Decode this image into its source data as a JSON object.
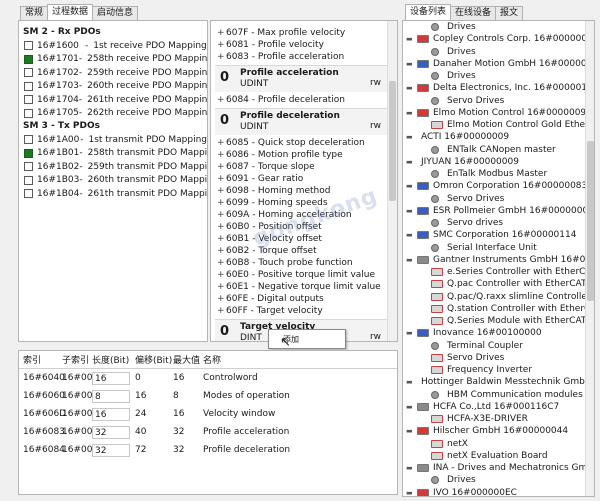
{
  "left_tabs": [
    "常规",
    "过程数据",
    "启动信息"
  ],
  "right_tabs": [
    "设备列表",
    "在线设备",
    "报文"
  ],
  "pdo": {
    "sections": [
      {
        "title": "SM 2 - Rx PDOs",
        "items": [
          {
            "index": "16#1600",
            "name": "1st receive PDO Mapping",
            "checked": false
          },
          {
            "index": "16#1701",
            "name": "258th receive PDO Mapping",
            "checked": true
          },
          {
            "index": "16#1702",
            "name": "259th receive PDO Mapping",
            "checked": false
          },
          {
            "index": "16#1703",
            "name": "260th receive PDO Mapping",
            "checked": false
          },
          {
            "index": "16#1704",
            "name": "261th receive PDO Mapping",
            "checked": false
          },
          {
            "index": "16#1705",
            "name": "262th receive PDO Mapping",
            "checked": false
          }
        ]
      },
      {
        "title": "SM 3 - Tx PDOs",
        "items": [
          {
            "index": "16#1A00",
            "name": "1st transmit PDO Mapping",
            "checked": false
          },
          {
            "index": "16#1B01",
            "name": "258th transmit PDO Mapping",
            "checked": true
          },
          {
            "index": "16#1B02",
            "name": "259th transmit PDO Mapping",
            "checked": false
          },
          {
            "index": "16#1B03",
            "name": "260th transmit PDO Mapping",
            "checked": false
          },
          {
            "index": "16#1B04",
            "name": "261th transmit PDO Mapping",
            "checked": false
          }
        ]
      }
    ]
  },
  "objects": [
    {
      "kind": "row",
      "text": "607F - Max profile velocity"
    },
    {
      "kind": "row",
      "text": "6081 - Profile velocity"
    },
    {
      "kind": "row",
      "text": "6083 - Profile acceleration"
    },
    {
      "kind": "box",
      "num": "0",
      "name": "Profile acceleration",
      "type": "UDINT",
      "access": "rw"
    },
    {
      "kind": "row",
      "text": "6084 - Profile deceleration"
    },
    {
      "kind": "box",
      "num": "0",
      "name": "Profile deceleration",
      "type": "UDINT",
      "access": "rw"
    },
    {
      "kind": "row",
      "text": "6085 - Quick stop deceleration"
    },
    {
      "kind": "row",
      "text": "6086 - Motion profile type"
    },
    {
      "kind": "row",
      "text": "6087 - Torque slope"
    },
    {
      "kind": "row",
      "text": "6091 - Gear ratio"
    },
    {
      "kind": "row",
      "text": "6098 - Homing method"
    },
    {
      "kind": "row",
      "text": "6099 - Homing speeds"
    },
    {
      "kind": "row",
      "text": "609A - Homing acceleration"
    },
    {
      "kind": "row",
      "text": "60B0 - Position offset"
    },
    {
      "kind": "row",
      "text": "60B1 - Velocity offset"
    },
    {
      "kind": "row",
      "text": "60B2 - Torque offset"
    },
    {
      "kind": "row",
      "text": "60B8 - Touch probe function"
    },
    {
      "kind": "row",
      "text": "60E0 - Positive torque limit value"
    },
    {
      "kind": "row",
      "text": "60E1 - Negative torque limit value"
    },
    {
      "kind": "row",
      "text": "60FE - Digital outputs"
    },
    {
      "kind": "row",
      "text": "60FF - Target velocity"
    },
    {
      "kind": "box",
      "num": "0",
      "name": "Target velocity",
      "type": "DINT",
      "access": "rw"
    }
  ],
  "popup_text": "添加",
  "watermark": "gongkong",
  "mapping": {
    "headers": [
      "索引",
      "子索引",
      "长度(Bit)",
      "偏移(Bit)",
      "最大值",
      "名称"
    ],
    "rows": [
      [
        "16#6040",
        "16#00",
        "16",
        "0",
        "16",
        "Controlword"
      ],
      [
        "16#6060",
        "16#00",
        "8",
        "16",
        "8",
        "Modes of operation"
      ],
      [
        "16#606D",
        "16#00",
        "16",
        "24",
        "16",
        "Velocity window"
      ],
      [
        "16#6083",
        "16#00",
        "32",
        "40",
        "32",
        "Profile acceleration"
      ],
      [
        "16#6084",
        "16#00",
        "32",
        "72",
        "32",
        "Profile deceleration"
      ]
    ]
  },
  "devices": [
    {
      "level": 2,
      "icon": "drive",
      "text": "Drives"
    },
    {
      "level": 1,
      "icon": "flag-red",
      "expand": "-",
      "text": "Copley Controls Corp.  16#000000AB"
    },
    {
      "level": 2,
      "icon": "drive",
      "text": "Drives"
    },
    {
      "level": 1,
      "icon": "flag-blue",
      "expand": "-",
      "text": "Danaher Motion GmbH  16#0000006A"
    },
    {
      "level": 2,
      "icon": "drive",
      "text": "Drives"
    },
    {
      "level": 1,
      "icon": "flag-red",
      "expand": "-",
      "text": "Delta Electronics, Inc.  16#000001DD"
    },
    {
      "level": 2,
      "icon": "drive",
      "text": "Servo Drives"
    },
    {
      "level": 1,
      "icon": "flag-red",
      "expand": "-",
      "text": "Elmo Motion Control  16#0000009A"
    },
    {
      "level": 2,
      "icon": "drv-red",
      "text": "Elmo Motion Control Gold EtherCAT"
    },
    {
      "level": 1,
      "icon": "none",
      "expand": "-",
      "text": "ACTI  16#00000009"
    },
    {
      "level": 2,
      "icon": "drive",
      "text": "ENTalk CANopen master"
    },
    {
      "level": 1,
      "icon": "none",
      "expand": "-",
      "text": "JIYUAN  16#00000009"
    },
    {
      "level": 2,
      "icon": "drive",
      "text": "EnTalk Modbus Master"
    },
    {
      "level": 1,
      "icon": "flag-blue",
      "expand": "-",
      "text": "Omron Corporation  16#00000083"
    },
    {
      "level": 2,
      "icon": "drive",
      "text": "Servo Drives"
    },
    {
      "level": 1,
      "icon": "flag-blue",
      "expand": "-",
      "text": "ESR Pollmeier GmbH  16#0000000F"
    },
    {
      "level": 2,
      "icon": "drive",
      "text": "Servo drives"
    },
    {
      "level": 1,
      "icon": "flag-blue",
      "expand": "-",
      "text": "SMC Corporation  16#00000114"
    },
    {
      "level": 2,
      "icon": "drive",
      "text": "Serial Interface Unit"
    },
    {
      "level": 1,
      "icon": "flag-gray",
      "expand": "-",
      "text": "Gantner Instruments GmbH  16#00000026"
    },
    {
      "level": 2,
      "icon": "drv-red",
      "text": "e.Series Controller with EtherCAT"
    },
    {
      "level": 2,
      "icon": "drv-red",
      "text": "Q.pac Controller with EtherCAT"
    },
    {
      "level": 2,
      "icon": "drv-red",
      "text": "Q.pac/Q.raxx slimline Controller with"
    },
    {
      "level": 2,
      "icon": "drv-red",
      "text": "Q.station Controller with EtherCAT"
    },
    {
      "level": 2,
      "icon": "drv-red",
      "text": "Q.Series Module with EtherCAT"
    },
    {
      "level": 1,
      "icon": "flag-blue",
      "expand": "-",
      "text": "Inovance  16#00100000"
    },
    {
      "level": 2,
      "icon": "drive",
      "text": "Terminal Coupler"
    },
    {
      "level": 2,
      "icon": "drv-red",
      "text": "Servo Drives"
    },
    {
      "level": 2,
      "icon": "drv-red",
      "text": "Frequency Inverter"
    },
    {
      "level": 1,
      "icon": "none",
      "expand": "-",
      "text": "Hottinger Baldwin Messtechnik GmbH"
    },
    {
      "level": 2,
      "icon": "drive",
      "text": "HBM Communication modules"
    },
    {
      "level": 1,
      "icon": "flag-gray",
      "expand": "-",
      "text": "HCFA Co.,Ltd  16#000116C7"
    },
    {
      "level": 2,
      "icon": "drv-red",
      "text": "HCFA-X3E-DRIVER"
    },
    {
      "level": 1,
      "icon": "flag-red",
      "expand": "-",
      "text": "Hilscher GmbH  16#00000044"
    },
    {
      "level": 2,
      "icon": "drv-red",
      "text": "netX"
    },
    {
      "level": 2,
      "icon": "drv-red",
      "text": "netX Evaluation Board"
    },
    {
      "level": 1,
      "icon": "flag-gray",
      "expand": "-",
      "text": "INA - Drives and Mechatronics GmbH u"
    },
    {
      "level": 2,
      "icon": "drive",
      "text": "Drives"
    },
    {
      "level": 1,
      "icon": "flag-red",
      "expand": "-",
      "text": "IVO  16#000000EC"
    }
  ],
  "colors": {
    "checked": "#1e7a1e",
    "flag-red": "#d23a3a",
    "flag-blue": "#3a5ec0",
    "flag-gray": "#8a8a8a",
    "drv-red": "#c84040"
  }
}
